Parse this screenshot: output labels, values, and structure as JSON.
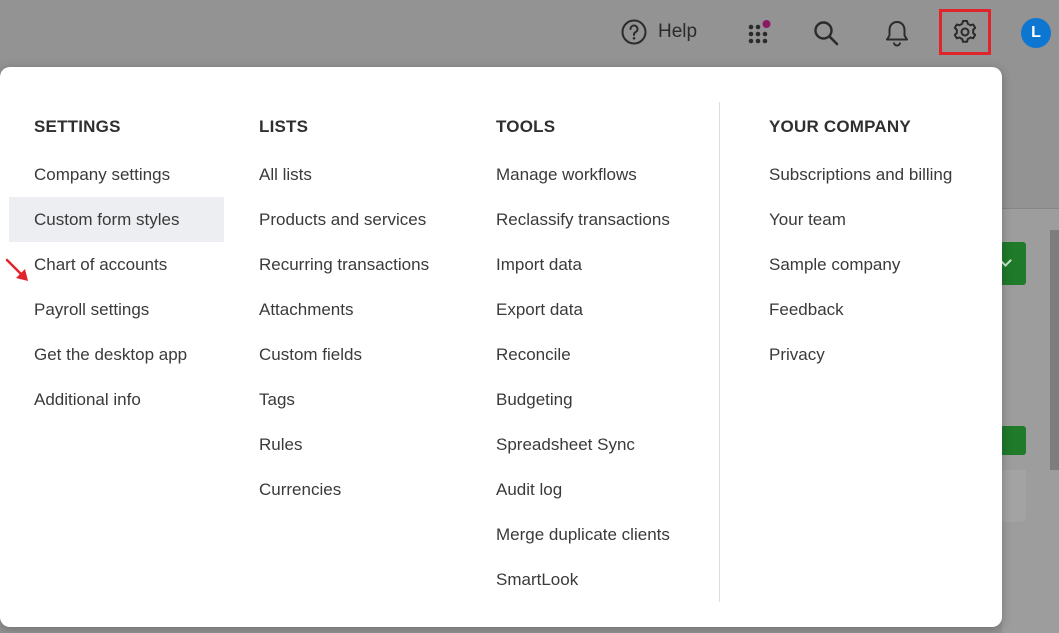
{
  "topbar": {
    "help_label": "Help",
    "avatar_initial": "L",
    "notification_dot_color": "#8a1a63",
    "gear_highlight_color": "#e0242c",
    "avatar_color": "#0d76d1"
  },
  "menu": {
    "settings": {
      "heading": "SETTINGS",
      "items": [
        "Company settings",
        "Custom form styles",
        "Chart of accounts",
        "Payroll settings",
        "Get the desktop app",
        "Additional info"
      ],
      "active_item": "Custom form styles"
    },
    "lists": {
      "heading": "LISTS",
      "items": [
        "All lists",
        "Products and services",
        "Recurring transactions",
        "Attachments",
        "Custom fields",
        "Tags",
        "Rules",
        "Currencies"
      ]
    },
    "tools": {
      "heading": "TOOLS",
      "items": [
        "Manage workflows",
        "Reclassify transactions",
        "Import data",
        "Export data",
        "Reconcile",
        "Budgeting",
        "Spreadsheet Sync",
        "Audit log",
        "Merge duplicate clients",
        "SmartLook"
      ]
    },
    "company": {
      "heading": "YOUR COMPANY",
      "items": [
        "Subscriptions and billing",
        "Your team",
        "Sample company",
        "Feedback",
        "Privacy"
      ]
    }
  },
  "annotation": {
    "arrow_color": "#e0242c"
  }
}
